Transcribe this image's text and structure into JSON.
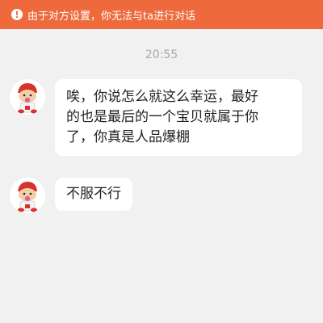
{
  "banner": {
    "icon": "exclamation-icon",
    "text": "由于对方设置，你无法与ta进行对话",
    "color": "#ee6a3c"
  },
  "timestamp": "20:55",
  "messages": [
    {
      "sender_avatar": "cartoon-baby-avatar",
      "lines": [
        "唉，你说怎么就这么幸运，最好",
        "的也是最后的一个宝贝就属于你",
        "了，你真是人品爆棚"
      ]
    },
    {
      "sender_avatar": "cartoon-baby-avatar",
      "text": "不服不行"
    }
  ]
}
